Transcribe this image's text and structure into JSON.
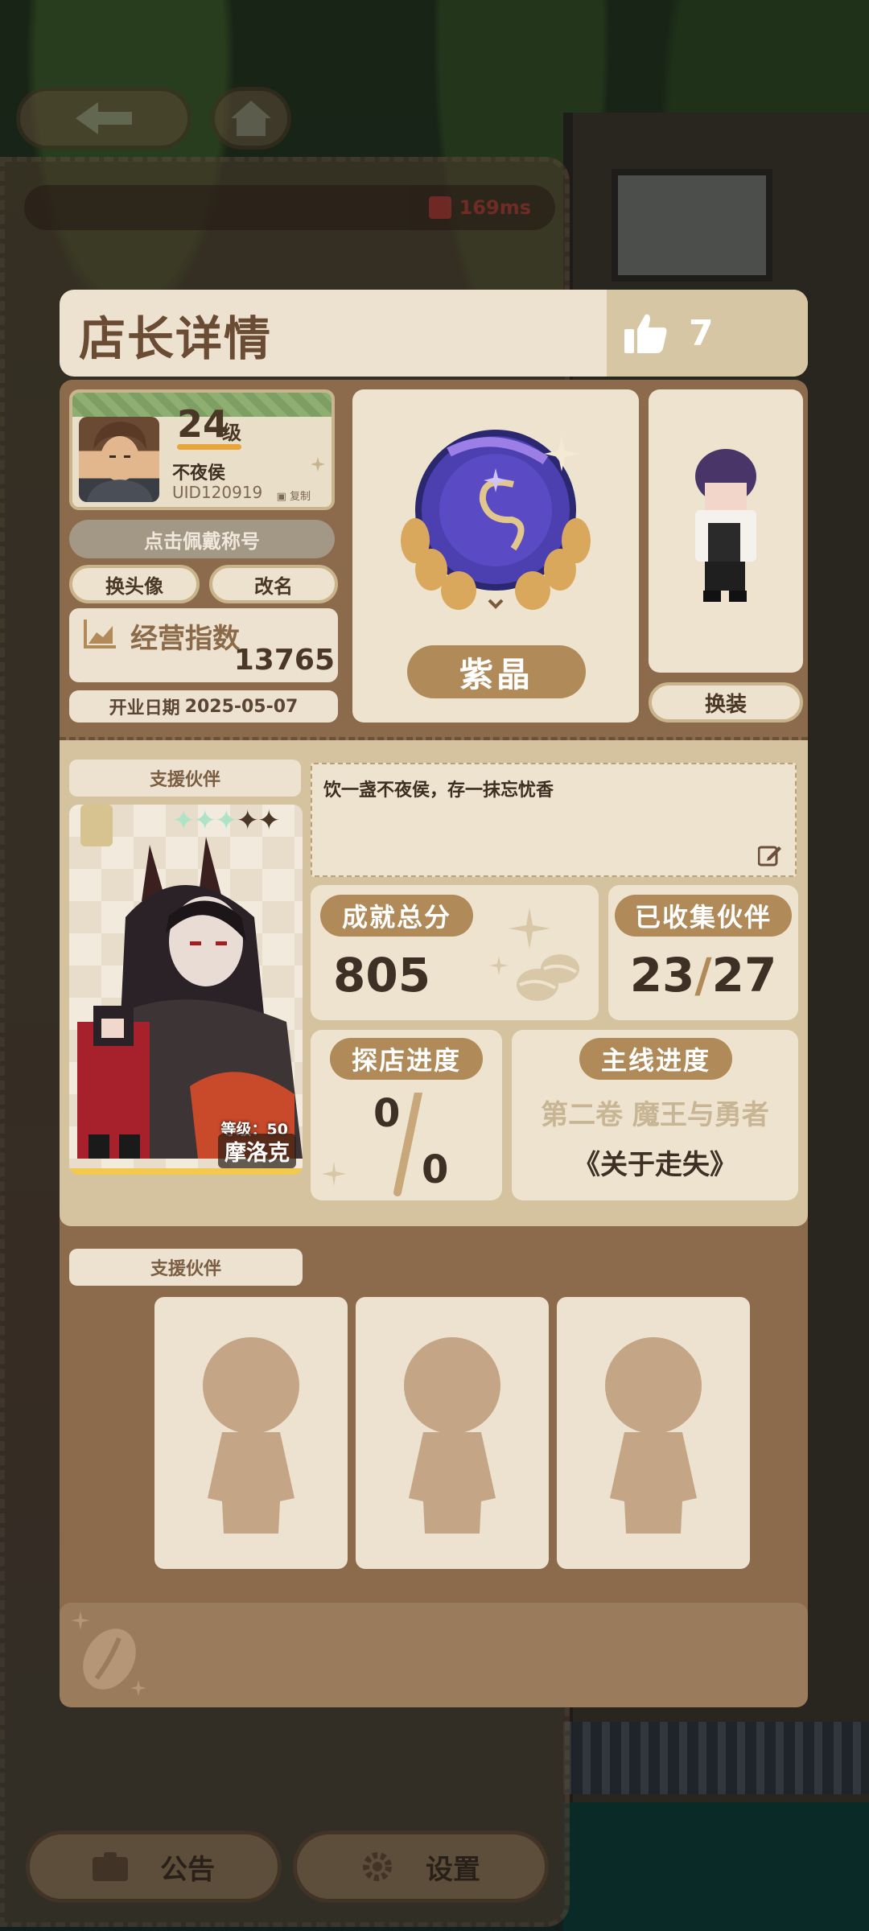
{
  "hud": {
    "ping": "169ms",
    "announcement": "公告",
    "settings": "设置"
  },
  "header": {
    "title": "店长详情",
    "likes": "7"
  },
  "profile": {
    "level": "24",
    "level_suffix": "级",
    "nickname": "不夜侯",
    "uid": "UID120919",
    "copy_label": "复制",
    "title_button": "点击佩戴称号",
    "change_avatar": "换头像",
    "rename": "改名",
    "business_label": "经营指数",
    "business_value": "13765",
    "open_date_label": "开业日期",
    "open_date_value": "2025-05-07",
    "badge_name": "紫晶",
    "change_outfit": "换装"
  },
  "partner": {
    "tag": "支援伙伴",
    "level": "等级：50",
    "name": "摩洛克",
    "stars_filled": 3,
    "stars_total": 5
  },
  "motto": "饮一盏不夜侯，存一抹忘忧香",
  "stats": {
    "achievement_label": "成就总分",
    "achievement_value": "805",
    "collected_label": "已收集伙伴",
    "collected_current": "23",
    "collected_total": "27",
    "explore_label": "探店进度",
    "explore_current": "0",
    "explore_total": "0",
    "main_label": "主线进度",
    "main_chapter": "第二卷 魔王与勇者",
    "main_episode": "《关于走失》"
  },
  "support": {
    "tag": "支援伙伴"
  },
  "colors": {
    "panel_brown": "#8c6a4c",
    "card_cream": "#ede3cf",
    "pill_gold": "#b08a58",
    "ping_red": "#c63a3a"
  },
  "icons": [
    "back-arrow-icon",
    "home-icon",
    "signal-icon",
    "thumbs-up-icon",
    "chart-icon",
    "edit-icon",
    "coffee-bean-icon",
    "sparkle-icon",
    "star-icon",
    "megaphone-icon",
    "gear-icon"
  ]
}
